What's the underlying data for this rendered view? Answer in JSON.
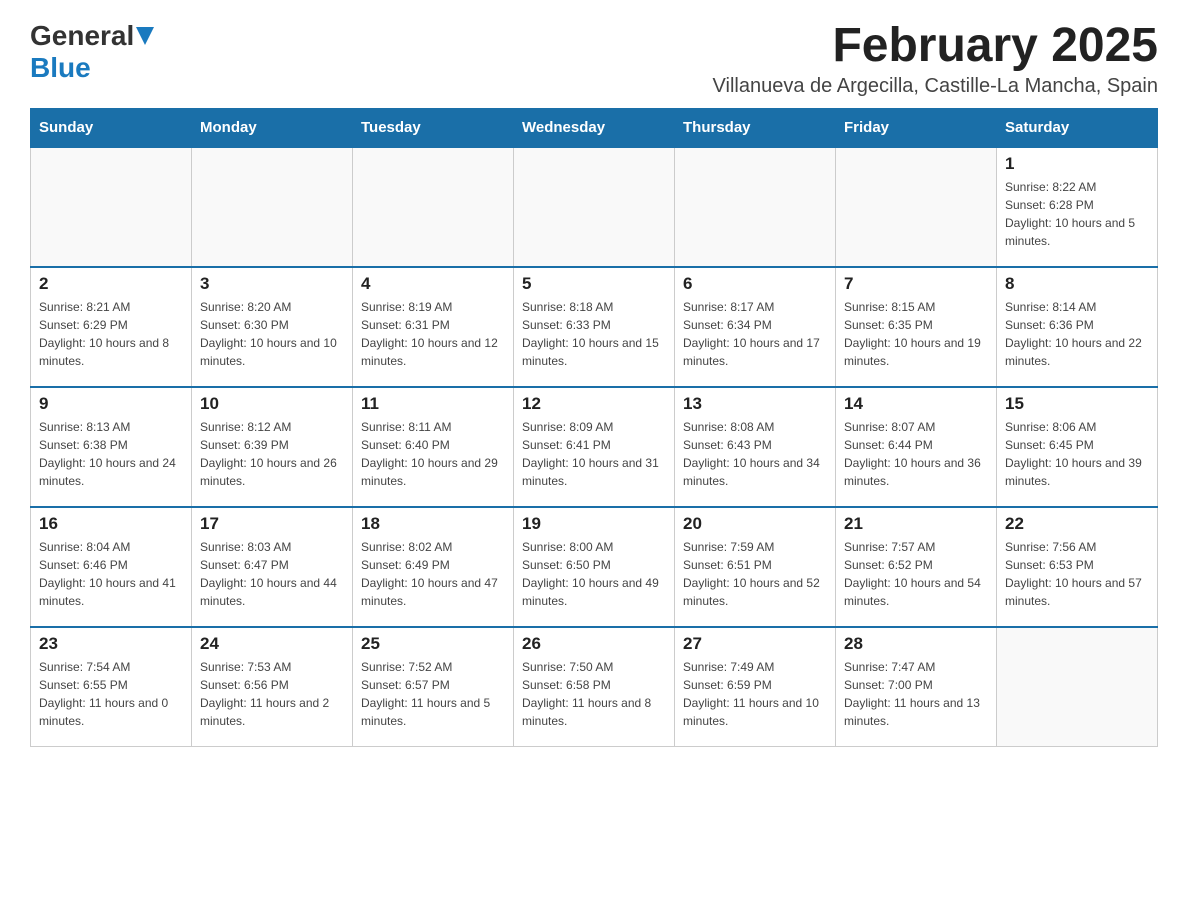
{
  "logo": {
    "general": "General",
    "blue": "Blue"
  },
  "title": "February 2025",
  "subtitle": "Villanueva de Argecilla, Castille-La Mancha, Spain",
  "weekdays": [
    "Sunday",
    "Monday",
    "Tuesday",
    "Wednesday",
    "Thursday",
    "Friday",
    "Saturday"
  ],
  "weeks": [
    [
      {
        "day": "",
        "sunrise": "",
        "sunset": "",
        "daylight": ""
      },
      {
        "day": "",
        "sunrise": "",
        "sunset": "",
        "daylight": ""
      },
      {
        "day": "",
        "sunrise": "",
        "sunset": "",
        "daylight": ""
      },
      {
        "day": "",
        "sunrise": "",
        "sunset": "",
        "daylight": ""
      },
      {
        "day": "",
        "sunrise": "",
        "sunset": "",
        "daylight": ""
      },
      {
        "day": "",
        "sunrise": "",
        "sunset": "",
        "daylight": ""
      },
      {
        "day": "1",
        "sunrise": "Sunrise: 8:22 AM",
        "sunset": "Sunset: 6:28 PM",
        "daylight": "Daylight: 10 hours and 5 minutes."
      }
    ],
    [
      {
        "day": "2",
        "sunrise": "Sunrise: 8:21 AM",
        "sunset": "Sunset: 6:29 PM",
        "daylight": "Daylight: 10 hours and 8 minutes."
      },
      {
        "day": "3",
        "sunrise": "Sunrise: 8:20 AM",
        "sunset": "Sunset: 6:30 PM",
        "daylight": "Daylight: 10 hours and 10 minutes."
      },
      {
        "day": "4",
        "sunrise": "Sunrise: 8:19 AM",
        "sunset": "Sunset: 6:31 PM",
        "daylight": "Daylight: 10 hours and 12 minutes."
      },
      {
        "day": "5",
        "sunrise": "Sunrise: 8:18 AM",
        "sunset": "Sunset: 6:33 PM",
        "daylight": "Daylight: 10 hours and 15 minutes."
      },
      {
        "day": "6",
        "sunrise": "Sunrise: 8:17 AM",
        "sunset": "Sunset: 6:34 PM",
        "daylight": "Daylight: 10 hours and 17 minutes."
      },
      {
        "day": "7",
        "sunrise": "Sunrise: 8:15 AM",
        "sunset": "Sunset: 6:35 PM",
        "daylight": "Daylight: 10 hours and 19 minutes."
      },
      {
        "day": "8",
        "sunrise": "Sunrise: 8:14 AM",
        "sunset": "Sunset: 6:36 PM",
        "daylight": "Daylight: 10 hours and 22 minutes."
      }
    ],
    [
      {
        "day": "9",
        "sunrise": "Sunrise: 8:13 AM",
        "sunset": "Sunset: 6:38 PM",
        "daylight": "Daylight: 10 hours and 24 minutes."
      },
      {
        "day": "10",
        "sunrise": "Sunrise: 8:12 AM",
        "sunset": "Sunset: 6:39 PM",
        "daylight": "Daylight: 10 hours and 26 minutes."
      },
      {
        "day": "11",
        "sunrise": "Sunrise: 8:11 AM",
        "sunset": "Sunset: 6:40 PM",
        "daylight": "Daylight: 10 hours and 29 minutes."
      },
      {
        "day": "12",
        "sunrise": "Sunrise: 8:09 AM",
        "sunset": "Sunset: 6:41 PM",
        "daylight": "Daylight: 10 hours and 31 minutes."
      },
      {
        "day": "13",
        "sunrise": "Sunrise: 8:08 AM",
        "sunset": "Sunset: 6:43 PM",
        "daylight": "Daylight: 10 hours and 34 minutes."
      },
      {
        "day": "14",
        "sunrise": "Sunrise: 8:07 AM",
        "sunset": "Sunset: 6:44 PM",
        "daylight": "Daylight: 10 hours and 36 minutes."
      },
      {
        "day": "15",
        "sunrise": "Sunrise: 8:06 AM",
        "sunset": "Sunset: 6:45 PM",
        "daylight": "Daylight: 10 hours and 39 minutes."
      }
    ],
    [
      {
        "day": "16",
        "sunrise": "Sunrise: 8:04 AM",
        "sunset": "Sunset: 6:46 PM",
        "daylight": "Daylight: 10 hours and 41 minutes."
      },
      {
        "day": "17",
        "sunrise": "Sunrise: 8:03 AM",
        "sunset": "Sunset: 6:47 PM",
        "daylight": "Daylight: 10 hours and 44 minutes."
      },
      {
        "day": "18",
        "sunrise": "Sunrise: 8:02 AM",
        "sunset": "Sunset: 6:49 PM",
        "daylight": "Daylight: 10 hours and 47 minutes."
      },
      {
        "day": "19",
        "sunrise": "Sunrise: 8:00 AM",
        "sunset": "Sunset: 6:50 PM",
        "daylight": "Daylight: 10 hours and 49 minutes."
      },
      {
        "day": "20",
        "sunrise": "Sunrise: 7:59 AM",
        "sunset": "Sunset: 6:51 PM",
        "daylight": "Daylight: 10 hours and 52 minutes."
      },
      {
        "day": "21",
        "sunrise": "Sunrise: 7:57 AM",
        "sunset": "Sunset: 6:52 PM",
        "daylight": "Daylight: 10 hours and 54 minutes."
      },
      {
        "day": "22",
        "sunrise": "Sunrise: 7:56 AM",
        "sunset": "Sunset: 6:53 PM",
        "daylight": "Daylight: 10 hours and 57 minutes."
      }
    ],
    [
      {
        "day": "23",
        "sunrise": "Sunrise: 7:54 AM",
        "sunset": "Sunset: 6:55 PM",
        "daylight": "Daylight: 11 hours and 0 minutes."
      },
      {
        "day": "24",
        "sunrise": "Sunrise: 7:53 AM",
        "sunset": "Sunset: 6:56 PM",
        "daylight": "Daylight: 11 hours and 2 minutes."
      },
      {
        "day": "25",
        "sunrise": "Sunrise: 7:52 AM",
        "sunset": "Sunset: 6:57 PM",
        "daylight": "Daylight: 11 hours and 5 minutes."
      },
      {
        "day": "26",
        "sunrise": "Sunrise: 7:50 AM",
        "sunset": "Sunset: 6:58 PM",
        "daylight": "Daylight: 11 hours and 8 minutes."
      },
      {
        "day": "27",
        "sunrise": "Sunrise: 7:49 AM",
        "sunset": "Sunset: 6:59 PM",
        "daylight": "Daylight: 11 hours and 10 minutes."
      },
      {
        "day": "28",
        "sunrise": "Sunrise: 7:47 AM",
        "sunset": "Sunset: 7:00 PM",
        "daylight": "Daylight: 11 hours and 13 minutes."
      },
      {
        "day": "",
        "sunrise": "",
        "sunset": "",
        "daylight": ""
      }
    ]
  ]
}
